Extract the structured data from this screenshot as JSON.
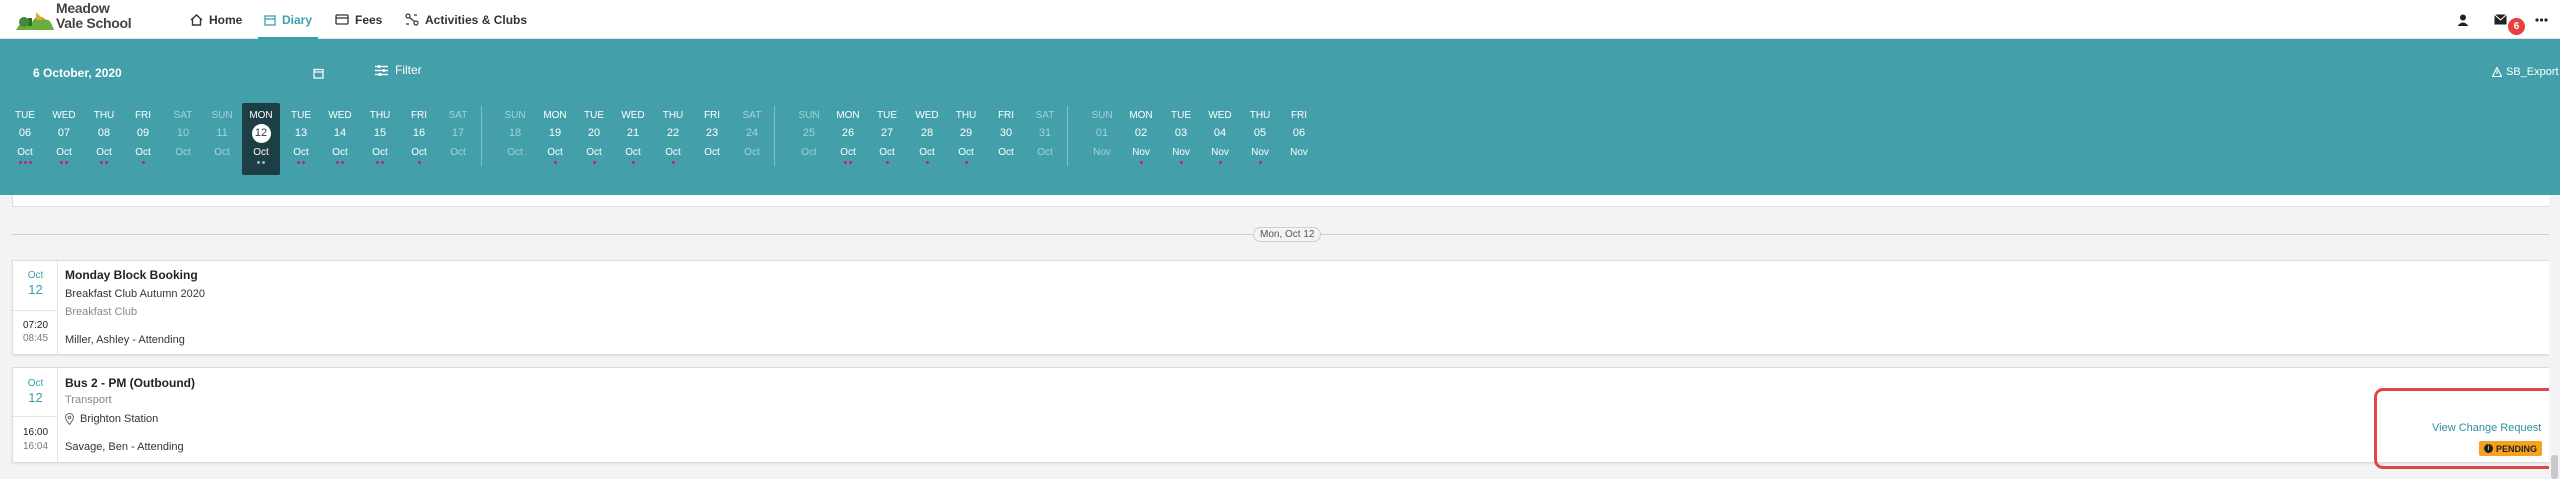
{
  "school": {
    "name_line1": "Meadow",
    "name_line2": "Vale School"
  },
  "nav": {
    "home": "Home",
    "diary": "Diary",
    "fees": "Fees",
    "activities": "Activities & Clubs"
  },
  "notifications": {
    "mail_count": "6"
  },
  "header": {
    "date_title": "6 October, 2020",
    "filter_label": "Filter",
    "export_label": "SB_Export"
  },
  "days": [
    {
      "name": "TUE",
      "date": "06",
      "month": "Oct",
      "dots": [
        "#b8267a",
        "#b8267a",
        "#b8267a"
      ]
    },
    {
      "name": "WED",
      "date": "07",
      "month": "Oct",
      "dots": [
        "#b8267a",
        "#b8267a"
      ]
    },
    {
      "name": "THU",
      "date": "08",
      "month": "Oct",
      "dots": [
        "#b8267a",
        "#b8267a"
      ]
    },
    {
      "name": "FRI",
      "date": "09",
      "month": "Oct",
      "dots": [
        "#b8267a"
      ]
    },
    {
      "name": "SAT",
      "date": "10",
      "month": "Oct",
      "dots": []
    },
    {
      "name": "SUN",
      "date": "11",
      "month": "Oct",
      "dots": []
    },
    {
      "name": "MON",
      "date": "12",
      "month": "Oct",
      "dots": [
        "#9fb6bb",
        "#9fb6bb"
      ]
    },
    {
      "name": "TUE",
      "date": "13",
      "month": "Oct",
      "dots": [
        "#b8267a",
        "#b8267a"
      ]
    },
    {
      "name": "WED",
      "date": "14",
      "month": "Oct",
      "dots": [
        "#b8267a",
        "#b8267a"
      ]
    },
    {
      "name": "THU",
      "date": "15",
      "month": "Oct",
      "dots": [
        "#b8267a",
        "#b8267a"
      ]
    },
    {
      "name": "FRI",
      "date": "16",
      "month": "Oct",
      "dots": [
        "#b8267a"
      ]
    },
    {
      "name": "SAT",
      "date": "17",
      "month": "Oct",
      "dots": []
    },
    {
      "name": "SUN",
      "date": "18",
      "month": "Oct",
      "dots": []
    },
    {
      "name": "MON",
      "date": "19",
      "month": "Oct",
      "dots": [
        "#b8267a"
      ]
    },
    {
      "name": "TUE",
      "date": "20",
      "month": "Oct",
      "dots": [
        "#b8267a"
      ]
    },
    {
      "name": "WED",
      "date": "21",
      "month": "Oct",
      "dots": [
        "#b8267a"
      ]
    },
    {
      "name": "THU",
      "date": "22",
      "month": "Oct",
      "dots": [
        "#b8267a"
      ]
    },
    {
      "name": "FRI",
      "date": "23",
      "month": "Oct",
      "dots": []
    },
    {
      "name": "SAT",
      "date": "24",
      "month": "Oct",
      "dots": []
    },
    {
      "name": "SUN",
      "date": "25",
      "month": "Oct",
      "dots": []
    },
    {
      "name": "MON",
      "date": "26",
      "month": "Oct",
      "dots": [
        "#b8267a",
        "#b8267a"
      ]
    },
    {
      "name": "TUE",
      "date": "27",
      "month": "Oct",
      "dots": [
        "#b8267a"
      ]
    },
    {
      "name": "WED",
      "date": "28",
      "month": "Oct",
      "dots": [
        "#b8267a"
      ]
    },
    {
      "name": "THU",
      "date": "29",
      "month": "Oct",
      "dots": [
        "#b8267a"
      ]
    },
    {
      "name": "FRI",
      "date": "30",
      "month": "Oct",
      "dots": []
    },
    {
      "name": "SAT",
      "date": "31",
      "month": "Oct",
      "dots": []
    },
    {
      "name": "SUN",
      "date": "01",
      "month": "Nov",
      "dots": []
    },
    {
      "name": "MON",
      "date": "02",
      "month": "Nov",
      "dots": [
        "#b8267a"
      ]
    },
    {
      "name": "TUE",
      "date": "03",
      "month": "Nov",
      "dots": [
        "#b8267a"
      ]
    },
    {
      "name": "WED",
      "date": "04",
      "month": "Nov",
      "dots": [
        "#b8267a"
      ]
    },
    {
      "name": "THU",
      "date": "05",
      "month": "Nov",
      "dots": [
        "#b8267a"
      ]
    },
    {
      "name": "FRI",
      "date": "06",
      "month": "Nov",
      "dots": []
    }
  ],
  "divider_label": "Mon, Oct 12",
  "events": [
    {
      "month": "Oct",
      "day": "12",
      "time_start": "07:20",
      "time_end": "08:45",
      "title": "Monday Block Booking",
      "subtitle": "Breakfast Club Autumn 2020",
      "category": "Breakfast Club",
      "attendee": "Miller, Ashley - Attending"
    },
    {
      "month": "Oct",
      "day": "12",
      "time_start": "16:00",
      "time_end": "16:04",
      "title": "Bus 2 - PM (Outbound)",
      "category": "Transport",
      "location": "Brighton Station",
      "attendee": "Savage, Ben - Attending",
      "action_link": "View Change Request",
      "status": "PENDING",
      "status_color": "#f6a21e"
    }
  ],
  "colors": {
    "teal": "#43a0ab",
    "selected_day": "#1d3e45",
    "accent": "#3a9ead",
    "highlight": "#e04646"
  }
}
